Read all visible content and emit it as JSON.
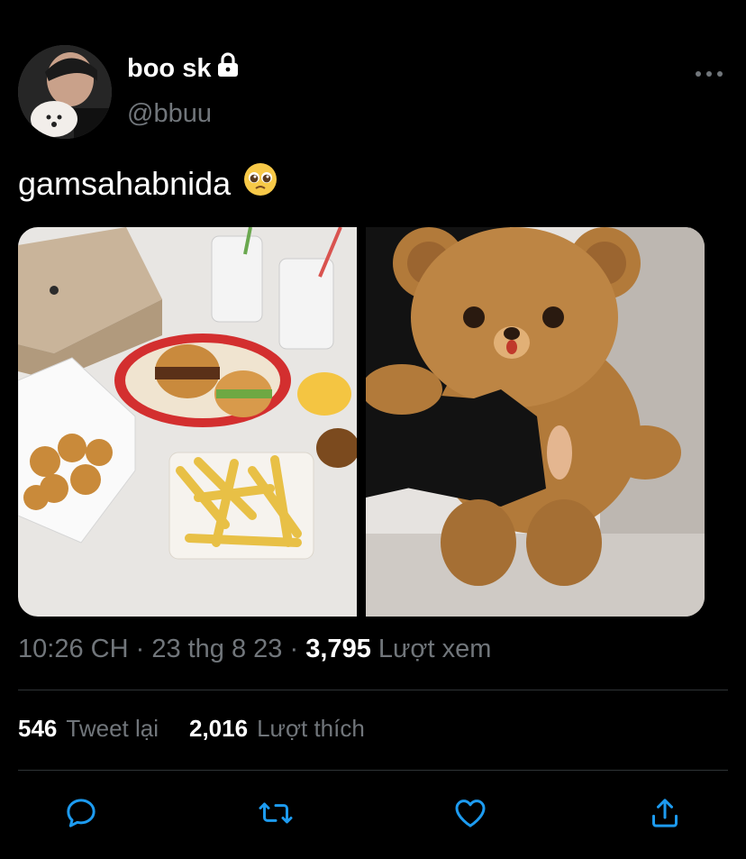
{
  "user": {
    "display_name": "boo sk",
    "handle": "@bbuu",
    "protected_icon": "lock-icon"
  },
  "tweet": {
    "text": "gamsahabnida",
    "emoji": "🥺"
  },
  "media": [
    {
      "description": "Shake Shack meal: burgers, crinkle fries, nuggets, shakes"
    },
    {
      "description": "Brown teddy bear plush held in front of a person"
    }
  ],
  "meta": {
    "time": "10:26 CH",
    "date": "23 thg 8 23",
    "views": "3,795",
    "views_label": "Lượt xem",
    "separator": "·"
  },
  "stats": {
    "retweets": "546",
    "retweets_label": "Tweet lại",
    "likes": "2,016",
    "likes_label": "Lượt thích"
  },
  "actions": [
    "reply-icon",
    "retweet-icon",
    "like-icon",
    "share-icon"
  ],
  "colors": {
    "background": "#000000",
    "muted": "#71767b",
    "text": "#ffffff",
    "divider": "#2f3336"
  }
}
